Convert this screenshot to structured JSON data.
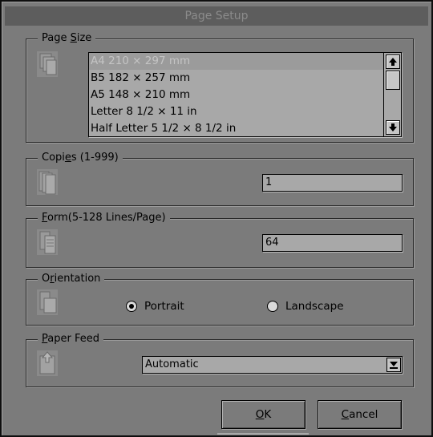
{
  "dialog": {
    "title": "Page Setup"
  },
  "page_size": {
    "legend_prefix": "Page ",
    "legend_accel": "S",
    "legend_suffix": "ize",
    "items": [
      {
        "label": "A4 210 × 297 mm",
        "selected": true
      },
      {
        "label": "B5 182 × 257 mm",
        "selected": false
      },
      {
        "label": "A5 148 × 210 mm",
        "selected": false
      },
      {
        "label": "Letter 8 1/2 × 11 in",
        "selected": false
      },
      {
        "label": "Half Letter 5 1/2 × 8 1/2 in",
        "selected": false
      }
    ]
  },
  "copies": {
    "legend_prefix": "Copi",
    "legend_accel": "e",
    "legend_suffix": "s (1-999)",
    "value": "1"
  },
  "form": {
    "legend_prefix": "",
    "legend_accel": "F",
    "legend_suffix": "orm(5-128 Lines/Page)",
    "value": "64"
  },
  "orientation": {
    "legend_prefix": "O",
    "legend_accel": "r",
    "legend_suffix": "ientation",
    "options": [
      {
        "label": "Portrait",
        "selected": true
      },
      {
        "label": "Landscape",
        "selected": false
      }
    ]
  },
  "paper_feed": {
    "legend_prefix": "",
    "legend_accel": "P",
    "legend_suffix": "aper Feed",
    "value": "Automatic"
  },
  "buttons": {
    "ok_accel": "O",
    "ok_rest": "K",
    "cancel_accel": "C",
    "cancel_rest": "ancel"
  },
  "colors": {
    "dialog_bg": "#7b7b7b",
    "field_bg": "#a8a8a8",
    "titlebar_bg": "#5d5d5d",
    "selected_bg": "#9b9b9b"
  }
}
